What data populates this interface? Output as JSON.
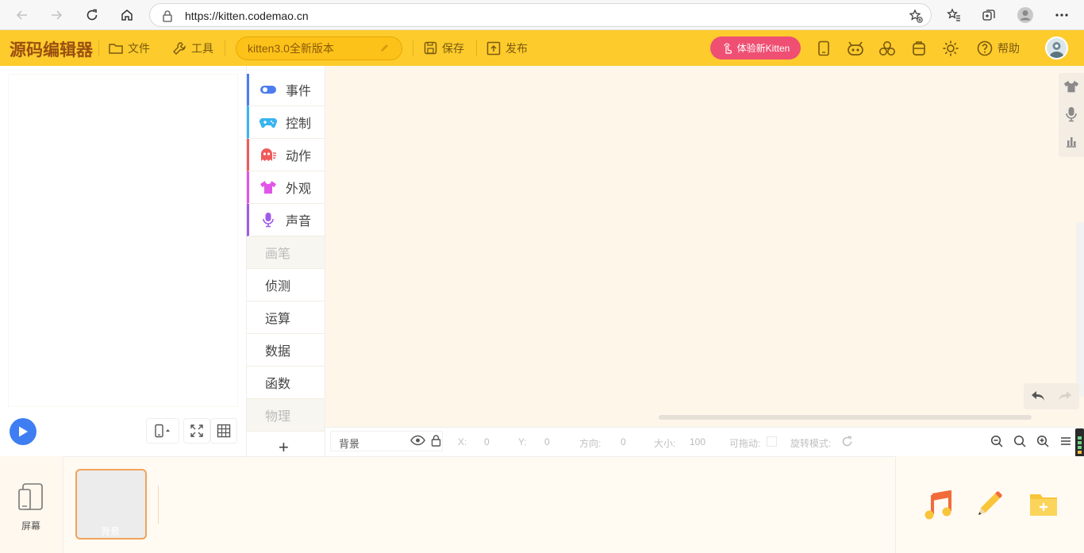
{
  "browser": {
    "url": "https://kitten.codemao.cn"
  },
  "toolbar": {
    "logo": "源码编辑器",
    "file_label": "文件",
    "tools_label": "工具",
    "version_label": "kitten3.0全新版本",
    "save_label": "保存",
    "publish_label": "发布",
    "try_label": "体验新Kitten",
    "help_label": "帮助"
  },
  "categories": [
    {
      "label": "事件",
      "icon": "toggle-icon",
      "color": "#4d7cf0"
    },
    {
      "label": "控制",
      "icon": "gamepad-icon",
      "color": "#3ab5f0"
    },
    {
      "label": "动作",
      "icon": "ghost-icon",
      "color": "#f05a5a"
    },
    {
      "label": "外观",
      "icon": "shirt-icon",
      "color": "#e155e8"
    },
    {
      "label": "声音",
      "icon": "microphone-icon",
      "color": "#a05ae8"
    },
    {
      "label": "画笔"
    },
    {
      "label": "侦测"
    },
    {
      "label": "运算"
    },
    {
      "label": "数据"
    },
    {
      "label": "函数"
    },
    {
      "label": "物理"
    }
  ],
  "add_category_symbol": "+",
  "props": {
    "sprite_name": "背景",
    "x_label": "X:",
    "x_value": "0",
    "y_label": "Y:",
    "y_value": "0",
    "dir_label": "方向:",
    "dir_value": "0",
    "size_label": "大小:",
    "size_value": "100",
    "drag_label": "可拖动:",
    "rotate_label": "旋转模式:"
  },
  "bottom": {
    "screen_label": "屏幕",
    "bg_label": "背景"
  }
}
